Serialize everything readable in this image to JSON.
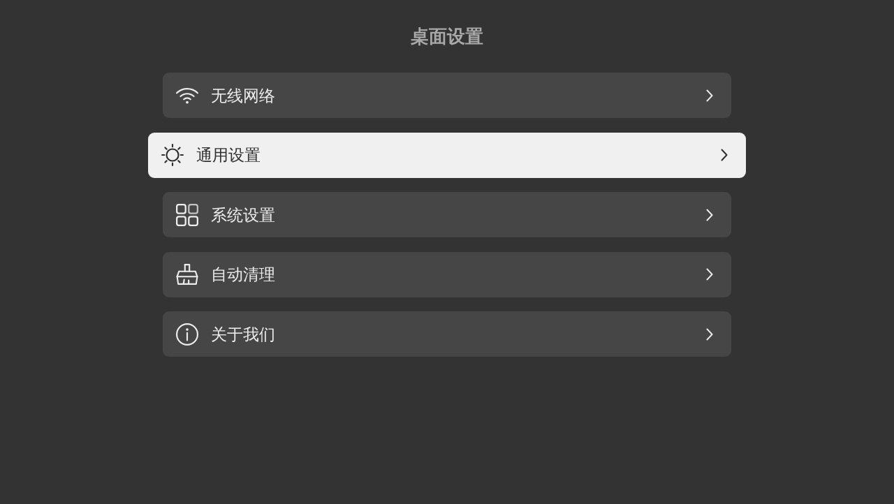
{
  "header": {
    "title": "桌面设置"
  },
  "menu": {
    "items": [
      {
        "kind": "wifi",
        "label": "无线网络",
        "selected": false
      },
      {
        "kind": "general",
        "label": "通用设置",
        "selected": true
      },
      {
        "kind": "system",
        "label": "系统设置",
        "selected": false
      },
      {
        "kind": "clean",
        "label": "自动清理",
        "selected": false
      },
      {
        "kind": "about",
        "label": "关于我们",
        "selected": false
      }
    ]
  }
}
